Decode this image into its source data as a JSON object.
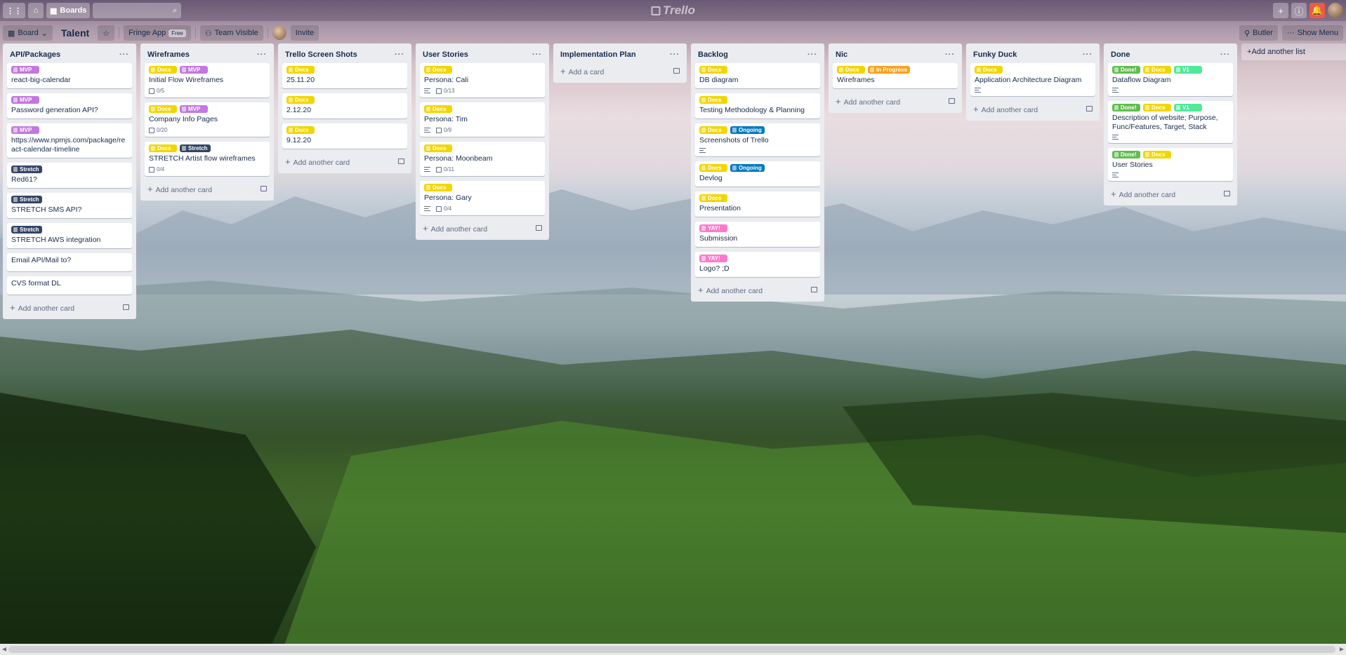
{
  "header": {
    "boards_label": "Boards",
    "logo_text": "Trello"
  },
  "board": {
    "view_label": "Board",
    "title": "Talent",
    "team_label": "Fringe App",
    "team_badge": "Free",
    "visibility_label": "Team Visible",
    "invite_label": "Invite",
    "butler_label": "Butler",
    "menu_label": "Show Menu",
    "add_list_label": "Add another list"
  },
  "label_colors": {
    "Docs": "#f2d600",
    "MVP": "#c377e0",
    "Stretch": "#344563",
    "Ongoing": "#0079bf",
    "In Progress": "#ff9f1a",
    "Done!": "#61bd4f",
    "V1": "#51e898",
    "YAY!": "#ff78cb"
  },
  "lists": [
    {
      "title": "API/Packages",
      "add_label": "Add another card",
      "cards": [
        {
          "labels": [
            "MVP"
          ],
          "title": "react-big-calendar",
          "desc": false,
          "checklist": ""
        },
        {
          "labels": [
            "MVP"
          ],
          "title": "Password generation API?",
          "desc": false,
          "checklist": ""
        },
        {
          "labels": [
            "MVP"
          ],
          "title": "https://www.npmjs.com/package/react-calendar-timeline",
          "desc": false,
          "checklist": ""
        },
        {
          "labels": [
            "Stretch"
          ],
          "title": "Red61?",
          "desc": false,
          "checklist": ""
        },
        {
          "labels": [
            "Stretch"
          ],
          "title": "STRETCH SMS API?",
          "desc": false,
          "checklist": ""
        },
        {
          "labels": [
            "Stretch"
          ],
          "title": "STRETCH AWS integration",
          "desc": false,
          "checklist": ""
        },
        {
          "labels": [],
          "title": "Email API/Mail to?",
          "desc": false,
          "checklist": ""
        },
        {
          "labels": [],
          "title": "CVS format DL",
          "desc": false,
          "checklist": ""
        }
      ]
    },
    {
      "title": "Wireframes",
      "add_label": "Add another card",
      "cards": [
        {
          "labels": [
            "Docs",
            "MVP"
          ],
          "title": "Initial Flow Wireframes",
          "desc": false,
          "checklist": "0/5"
        },
        {
          "labels": [
            "Docs",
            "MVP"
          ],
          "title": "Company Info Pages",
          "desc": false,
          "checklist": "0/20"
        },
        {
          "labels": [
            "Docs",
            "Stretch"
          ],
          "title": "STRETCH Artist flow wireframes",
          "desc": false,
          "checklist": "0/4"
        }
      ]
    },
    {
      "title": "Trello Screen Shots",
      "add_label": "Add another card",
      "cards": [
        {
          "labels": [
            "Docs"
          ],
          "title": "25.11.20",
          "desc": false,
          "checklist": ""
        },
        {
          "labels": [
            "Docs"
          ],
          "title": "2.12.20",
          "desc": false,
          "checklist": ""
        },
        {
          "labels": [
            "Docs"
          ],
          "title": "9.12.20",
          "desc": false,
          "checklist": ""
        }
      ]
    },
    {
      "title": "User Stories",
      "add_label": "Add another card",
      "cards": [
        {
          "labels": [
            "Docs"
          ],
          "title": "Persona: Cali",
          "desc": true,
          "checklist": "0/13"
        },
        {
          "labels": [
            "Docs"
          ],
          "title": "Persona: Tim",
          "desc": true,
          "checklist": "0/9"
        },
        {
          "labels": [
            "Docs"
          ],
          "title": "Persona: Moonbeam",
          "desc": true,
          "checklist": "0/11"
        },
        {
          "labels": [
            "Docs"
          ],
          "title": "Persona: Gary",
          "desc": true,
          "checklist": "0/4"
        }
      ]
    },
    {
      "title": "Implementation Plan",
      "add_label": "Add a card",
      "cards": []
    },
    {
      "title": "Backlog",
      "add_label": "Add another card",
      "cards": [
        {
          "labels": [
            "Docs"
          ],
          "title": "DB diagram",
          "desc": false,
          "checklist": ""
        },
        {
          "labels": [
            "Docs"
          ],
          "title": "Testing Methodology & Planning",
          "desc": false,
          "checklist": ""
        },
        {
          "labels": [
            "Docs",
            "Ongoing"
          ],
          "title": "Screenshots of Trello",
          "desc": true,
          "checklist": ""
        },
        {
          "labels": [
            "Docs",
            "Ongoing"
          ],
          "title": "Devlog",
          "desc": false,
          "checklist": ""
        },
        {
          "labels": [
            "Docs"
          ],
          "title": "Presentation",
          "desc": false,
          "checklist": ""
        },
        {
          "labels": [
            "YAY!"
          ],
          "title": "Submission",
          "desc": false,
          "checklist": ""
        },
        {
          "labels": [
            "YAY!"
          ],
          "title": "Logo? ;D",
          "desc": false,
          "checklist": ""
        }
      ]
    },
    {
      "title": "Nic",
      "add_label": "Add another card",
      "cards": [
        {
          "labels": [
            "Docs",
            "In Progress"
          ],
          "title": "Wireframes",
          "desc": false,
          "checklist": ""
        }
      ]
    },
    {
      "title": "Funky Duck",
      "add_label": "Add another card",
      "cards": [
        {
          "labels": [
            "Docs"
          ],
          "title": "Application Architecture Diagram",
          "desc": true,
          "checklist": ""
        }
      ]
    },
    {
      "title": "Done",
      "add_label": "Add another card",
      "cards": [
        {
          "labels": [
            "Done!",
            "Docs",
            "V1"
          ],
          "title": "Dataflow Diagram",
          "desc": true,
          "checklist": ""
        },
        {
          "labels": [
            "Done!",
            "Docs",
            "V1"
          ],
          "title": "Description of website; Purpose, Func/Features, Target, Stack",
          "desc": true,
          "checklist": ""
        },
        {
          "labels": [
            "Done!",
            "Docs"
          ],
          "title": "User Stories",
          "desc": true,
          "checklist": ""
        }
      ]
    }
  ]
}
